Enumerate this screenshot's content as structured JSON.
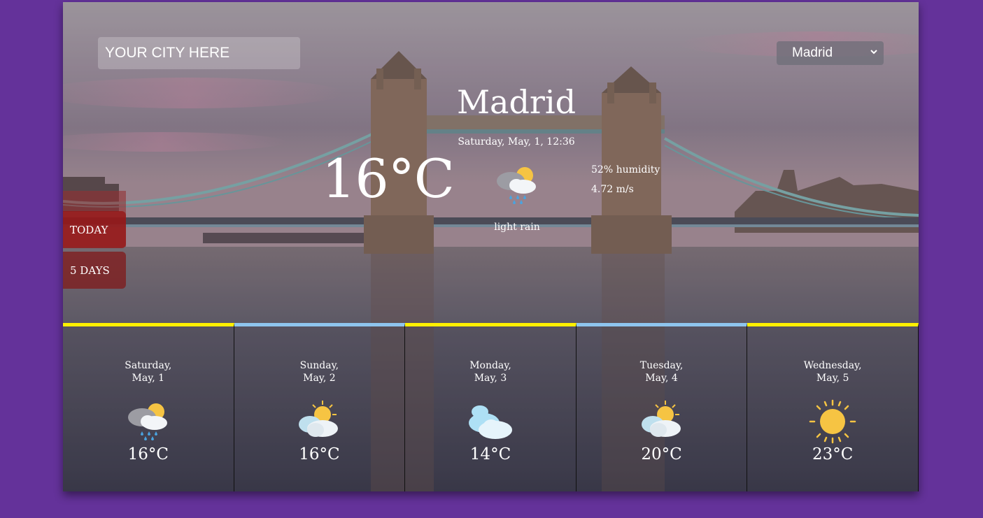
{
  "search": {
    "placeholder": "YOUR CITY HERE",
    "value": ""
  },
  "city_select": {
    "selected": "Madrid"
  },
  "current": {
    "city": "Madrid",
    "datetime": "Saturday, May, 1, 12:36",
    "temperature": "16°C",
    "icon": "cloud-sun-rain-icon",
    "description": "light rain",
    "humidity": "52% humidity",
    "wind": "4.72 m/s"
  },
  "tabs": {
    "today": "TODAY",
    "five_days": "5 DAYS"
  },
  "forecast": [
    {
      "day": "Saturday,",
      "date": "May, 1",
      "icon": "cloud-sun-rain-icon",
      "temp": "16°C",
      "accent": "#fff000"
    },
    {
      "day": "Sunday,",
      "date": "May, 2",
      "icon": "sun-behind-clouds-icon",
      "temp": "16°C",
      "accent": "#8ec5ee"
    },
    {
      "day": "Monday,",
      "date": "May, 3",
      "icon": "clouds-icon",
      "temp": "14°C",
      "accent": "#fff000"
    },
    {
      "day": "Tuesday,",
      "date": "May, 4",
      "icon": "sun-behind-clouds-icon",
      "temp": "20°C",
      "accent": "#8ec5ee"
    },
    {
      "day": "Wednesday,",
      "date": "May, 5",
      "icon": "sun-icon",
      "temp": "23°C",
      "accent": "#fff000"
    }
  ],
  "colors": {
    "page_bg": "#64329a",
    "accent_yellow": "#fff000",
    "accent_blue": "#8ec5ee",
    "tab_red": "#961414"
  }
}
